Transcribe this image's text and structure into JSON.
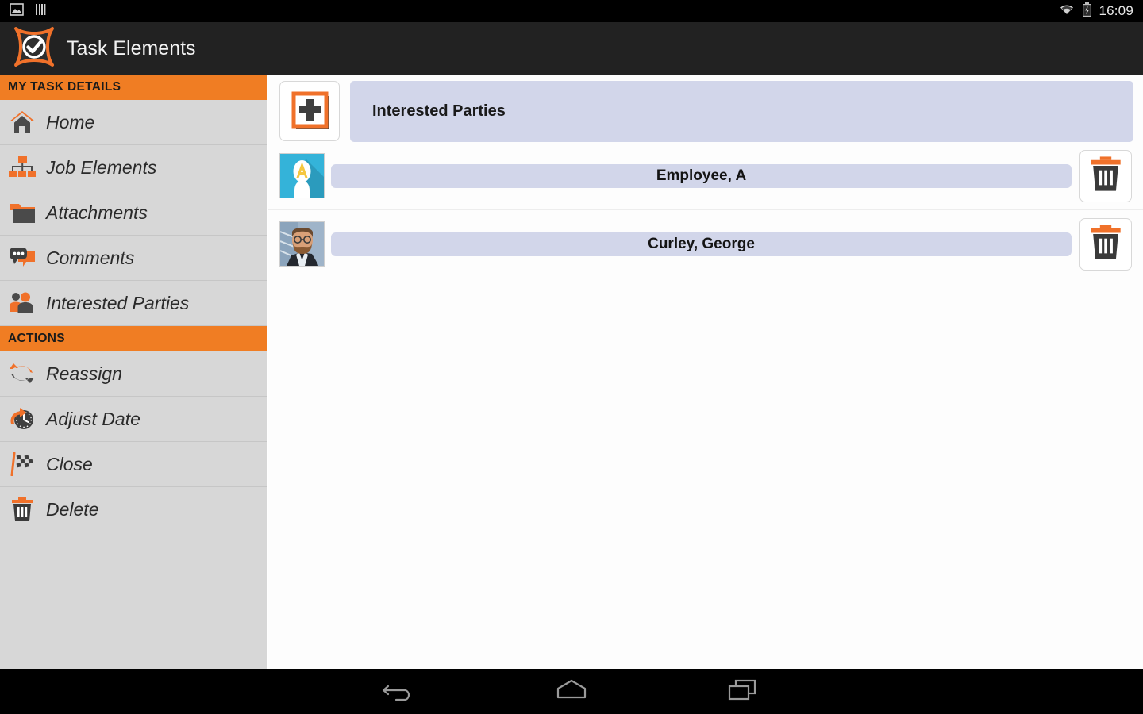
{
  "statusbar": {
    "time": "16:09",
    "icons": [
      "image-icon",
      "barcode-icon",
      "wifi-icon",
      "battery-charging-icon"
    ]
  },
  "actionbar": {
    "title": "Task Elements",
    "logo": "task-elements-logo"
  },
  "sidebar": {
    "sections": [
      {
        "title": "MY TASK DETAILS",
        "items": [
          {
            "label": "Home",
            "icon": "home-icon"
          },
          {
            "label": "Job Elements",
            "icon": "hierarchy-icon"
          },
          {
            "label": "Attachments",
            "icon": "folder-icon"
          },
          {
            "label": "Comments",
            "icon": "speech-bubble-icon"
          },
          {
            "label": "Interested Parties",
            "icon": "people-icon"
          }
        ]
      },
      {
        "title": "ACTIONS",
        "items": [
          {
            "label": "Reassign",
            "icon": "reassign-arrows-icon"
          },
          {
            "label": "Adjust Date",
            "icon": "clock-arrow-icon"
          },
          {
            "label": "Close",
            "icon": "checkered-flag-icon"
          },
          {
            "label": "Delete",
            "icon": "trash-icon"
          }
        ]
      }
    ]
  },
  "content": {
    "add_button_icon": "add-plus-icon",
    "header_title": "Interested Parties",
    "parties": [
      {
        "name": "Employee, A",
        "avatar": "placeholder-avatar-a",
        "delete_icon": "trash-icon"
      },
      {
        "name": "Curley, George",
        "avatar": "photo-avatar-george",
        "delete_icon": "trash-icon"
      }
    ]
  },
  "navbar": {
    "buttons": [
      {
        "name": "back",
        "icon": "back-arrow-icon"
      },
      {
        "name": "home",
        "icon": "home-pentagon-icon"
      },
      {
        "name": "recents",
        "icon": "recents-squares-icon"
      }
    ]
  },
  "colors": {
    "accent_orange": "#f07d23",
    "bar_lavender": "#d2d6ea",
    "sidebar_gray": "#d7d7d7",
    "actionbar_dark": "#222222"
  }
}
